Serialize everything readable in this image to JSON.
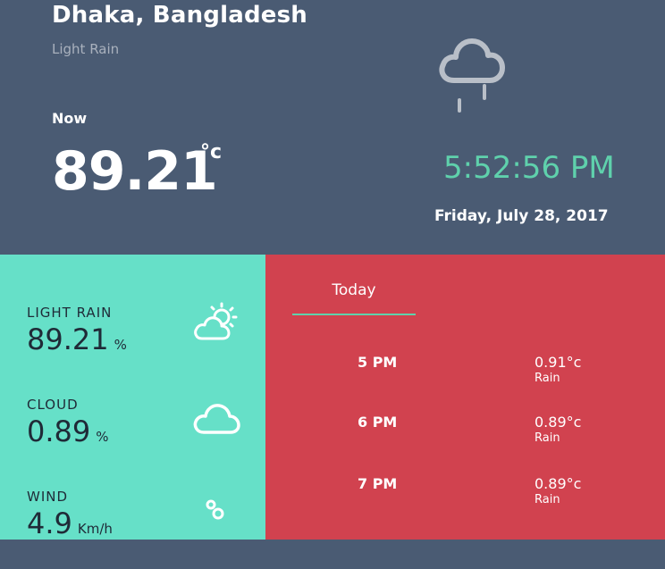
{
  "header": {
    "city": "Dhaka, Bangladesh",
    "condition": "Light Rain",
    "now_label": "Now",
    "temperature": "89.21",
    "temp_unit": "°c",
    "time": "5:52:56 PM",
    "date": "Friday, July 28, 2017"
  },
  "stats": [
    {
      "label": "LIGHT RAIN",
      "value": "89.21",
      "unit": "%",
      "icon": "partly-cloudy-sun-icon"
    },
    {
      "label": "CLOUD",
      "value": "0.89",
      "unit": "%",
      "icon": "cloud-icon"
    },
    {
      "label": "WIND",
      "value": "4.9",
      "unit": "Km/h",
      "icon": "wind-icon"
    }
  ],
  "forecast": {
    "tab": "Today",
    "rows": [
      {
        "hour": "5 PM",
        "temp": "0.91°c",
        "condition": "Rain"
      },
      {
        "hour": "6 PM",
        "temp": "0.89°c",
        "condition": "Rain"
      },
      {
        "hour": "7 PM",
        "temp": "0.89°c",
        "condition": "Rain"
      }
    ]
  },
  "colors": {
    "header_bg": "#4a5b73",
    "accent_green": "#5fd1ac",
    "stats_bg": "#66e0c8",
    "forecast_bg": "#d1424f"
  }
}
